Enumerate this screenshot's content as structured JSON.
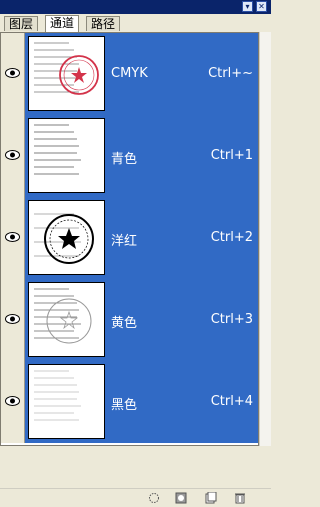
{
  "tabs": [
    {
      "label": "图层",
      "active": false
    },
    {
      "label": "通道",
      "active": true
    },
    {
      "label": "路径",
      "active": false
    }
  ],
  "window_buttons": [
    "▾",
    "✕"
  ],
  "channels": [
    {
      "name": "CMYK",
      "shortcut": "Ctrl+~",
      "thumb": "color-seal"
    },
    {
      "name": "青色",
      "shortcut": "Ctrl+1",
      "thumb": "text-only"
    },
    {
      "name": "洋红",
      "shortcut": "Ctrl+2",
      "thumb": "seal-star"
    },
    {
      "name": "黄色",
      "shortcut": "Ctrl+3",
      "thumb": "faint-seal"
    },
    {
      "name": "黑色",
      "shortcut": "Ctrl+4",
      "thumb": "faint-text"
    }
  ],
  "bottom_icons": [
    "load-selection-icon",
    "save-selection-icon",
    "new-channel-icon",
    "trash-icon"
  ],
  "colors": {
    "selection": "#316ac5",
    "panel": "#ece9d8",
    "seal": "#d3334a"
  }
}
